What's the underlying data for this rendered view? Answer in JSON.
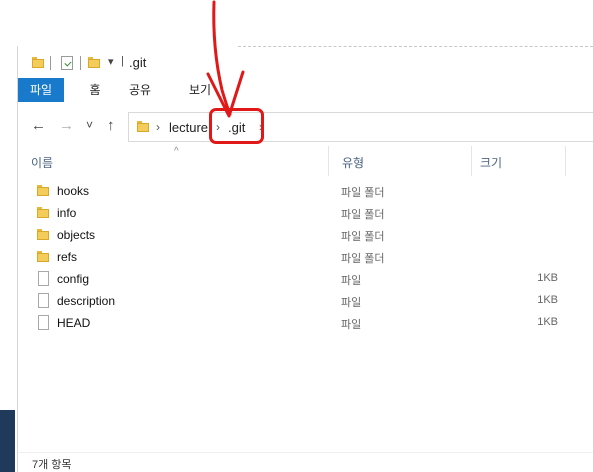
{
  "window": {
    "title": ".git",
    "qa_dropdown": "▾",
    "qa_pipe": "|"
  },
  "ribbon": {
    "tabs": [
      {
        "label": "파일",
        "active": true
      },
      {
        "label": "홈"
      },
      {
        "label": "공유"
      },
      {
        "label": "보기"
      }
    ]
  },
  "nav": {
    "back_icon": "←",
    "forward_icon": "→",
    "recent_icon": "˅",
    "up_icon": "↑"
  },
  "address": {
    "separator": "›",
    "crumbs": [
      "lecture",
      ".git"
    ],
    "trailing_separator": "›"
  },
  "columns": {
    "name": "이름",
    "type": "유형",
    "size": "크기",
    "sort_indicator": "^"
  },
  "files": [
    {
      "name": "hooks",
      "type": "파일 폴더",
      "size": "",
      "icon": "folder-icon"
    },
    {
      "name": "info",
      "type": "파일 폴더",
      "size": "",
      "icon": "folder-icon"
    },
    {
      "name": "objects",
      "type": "파일 폴더",
      "size": "",
      "icon": "folder-icon"
    },
    {
      "name": "refs",
      "type": "파일 폴더",
      "size": "",
      "icon": "folder-icon"
    },
    {
      "name": "config",
      "type": "파일",
      "size": "1KB",
      "icon": "file-icon"
    },
    {
      "name": "description",
      "type": "파일",
      "size": "1KB",
      "icon": "file-icon"
    },
    {
      "name": "HEAD",
      "type": "파일",
      "size": "1KB",
      "icon": "file-icon"
    }
  ],
  "status": {
    "item_count": "7개 항목"
  },
  "colors": {
    "ribbon_file_tab": "#1979ca",
    "annotation_red": "#e01818",
    "folder_yellow": "#f3cc5a"
  }
}
